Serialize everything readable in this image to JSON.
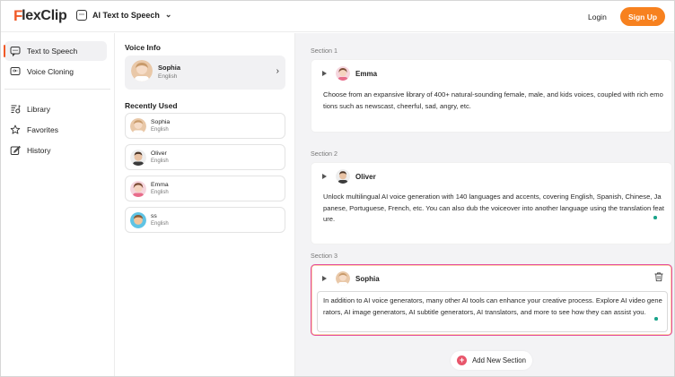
{
  "header": {
    "logo_f": "F",
    "logo_rest": "lexClip",
    "product_label": "AI Text to Speech",
    "login_label": "Login",
    "signup_label": "Sign Up",
    "colors": {
      "brand": "#f05a28",
      "signup": "#f7811f"
    }
  },
  "sidebar": {
    "items": [
      {
        "label": "Text to Speech",
        "icon": "chat-bubble-icon",
        "active": true
      },
      {
        "label": "Voice Cloning",
        "icon": "voice-wave-icon",
        "active": false
      },
      {
        "label": "Library",
        "icon": "library-icon",
        "active": false
      },
      {
        "label": "Favorites",
        "icon": "star-icon",
        "active": false
      },
      {
        "label": "History",
        "icon": "edit-history-icon",
        "active": false
      }
    ]
  },
  "voice_panel": {
    "voice_info_title": "Voice Info",
    "current_voice": {
      "name": "Sophia",
      "language": "English"
    },
    "recently_used_title": "Recently Used",
    "recent": [
      {
        "name": "Sophia",
        "language": "English"
      },
      {
        "name": "Oliver",
        "language": "English"
      },
      {
        "name": "Emma",
        "language": "English"
      },
      {
        "name": "ss",
        "language": "English"
      }
    ]
  },
  "main": {
    "sections": [
      {
        "label": "Section 1",
        "speaker": "Emma",
        "text": "Choose from an expansive library of 400+ natural-sounding female, male, and kids voices, coupled with rich emotions such as newscast, cheerful, sad, angry, etc."
      },
      {
        "label": "Section 2",
        "speaker": "Oliver",
        "text": "Unlock multilingual AI voice generation with 140 languages and accents, covering English, Spanish, Chinese, Japanese, Portuguese, French, etc. You can also dub the voiceover into another language using the translation feature."
      },
      {
        "label": "Section 3",
        "speaker": "Sophia",
        "text": "In addition to AI voice generators, many other AI tools can enhance your creative process. Explore AI video generators, AI image generators, AI subtitle generators, AI translators, and more to see how they can assist you."
      }
    ],
    "add_section_label": "Add New Section",
    "colors": {
      "active_border": "#e44d9e",
      "status_dot": "#19a38a",
      "add_plus": "#e8566b"
    }
  }
}
